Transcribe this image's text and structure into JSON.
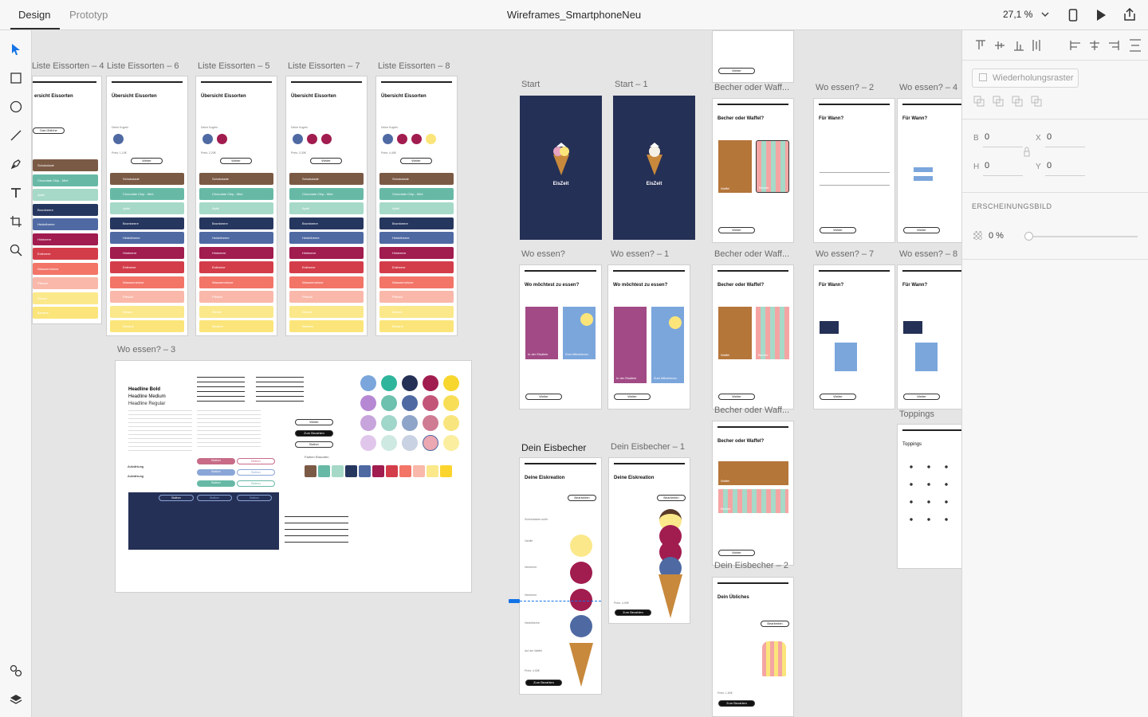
{
  "app": {
    "tabs": [
      "Design",
      "Prototyp"
    ],
    "document_title": "Wireframes_SmartphoneNeu",
    "zoom": "27,1 %"
  },
  "artboards": {
    "list_4": "Liste Eissorten – 4",
    "list_6": "Liste Eissorten – 6",
    "list_5": "Liste Eissorten – 5",
    "list_7": "Liste Eissorten – 7",
    "list_8": "Liste Eissorten – 8",
    "start": "Start",
    "start_1": "Start – 1",
    "wo_essen": "Wo essen?",
    "wo_essen_1": "Wo essen? – 1",
    "wo_essen_2": "Wo essen? – 2",
    "wo_essen_3": "Wo essen? – 3",
    "wo_essen_4": "Wo essen? – 4",
    "wo_essen_7": "Wo essen? – 7",
    "wo_essen_8": "Wo essen? – 8",
    "becher_1": "Becher oder Waff...",
    "becher_2": "Becher oder Waff...",
    "becher_3": "Becher oder Waff...",
    "dein_eisbecher": "Dein Eisbecher",
    "dein_eisbecher_1": "Dein Eisbecher – 1",
    "dein_eisbecher_2": "Dein Eisbecher – 2",
    "toppings": "Toppings"
  },
  "screens": {
    "uebersicht": "Übersicht Eissorten",
    "uebersicht_partial": "ersicht Eissorten",
    "deine_kugeln": "Deine Kugeln",
    "weiter": "Weiter",
    "preis_1": "Preis: 1,10€",
    "preis_2": "Preis: 2,20€",
    "preis_3": "Preis: 3,30€",
    "preis_4": "Preis: 4,40€",
    "das_uebliche": "Das Übliche",
    "flavors": [
      "Schokolade",
      "Chocolate Chip - Mint",
      "Apfel",
      "Brombeere",
      "Heidelbeere",
      "Himbeere",
      "Erdbeere",
      "Wassermelone",
      "Pfirsich",
      "Zitrone",
      "Banane"
    ],
    "app_name": "EisZeit",
    "wo_moechtest": "Wo möchtest zu essen?",
    "in_der_eisdiele": "In der Eisdiele",
    "zum_mitnehmen": "Zum Mitnehmen",
    "becher_oder_waffel": "Becher oder Waffel?",
    "waffel": "Waffel",
    "becher": "Becher",
    "fuer_wann": "Für Wann?",
    "dein_eiskreation": "Deine Eiskreation",
    "bearbeiten": "Bearbeiten",
    "zum_bezahlen": "Zum Bezahlen",
    "preis_490": "Preis: 4,90€",
    "dein_uebliches": "Dein Übliches",
    "preis_160": "Preis: 1,60€",
    "toppings_title": "Toppings",
    "scoop_labels": [
      "Schokoladen-soße",
      "Vanille",
      "Himbeere",
      "Himbeere",
      "Heidelbeere",
      "Auf der Waffel"
    ],
    "styleguide": {
      "headline_bold": "Headline Bold",
      "headline_medium": "Headline Medium",
      "headline_regular": "Headline Regular",
      "button": "Button",
      "weiter": "Weiter",
      "zum_bezahlen": "Zum Bezahlen",
      "farben_eissorten": "Farben Eissorten",
      "aufzaehlung": "Aufzählung"
    }
  },
  "right_panel": {
    "repeat_grid": "Wiederholungsraster",
    "b_label": "B",
    "b_value": "0",
    "x_label": "X",
    "x_value": "0",
    "h_label": "H",
    "h_value": "0",
    "y_label": "Y",
    "y_value": "0",
    "appearance": "ERSCHEINUNGSBILD",
    "opacity": "0 %"
  },
  "colors": {
    "navy": "#253056",
    "schoko": "#7b5a45",
    "mint": "#67b9a6",
    "apfel": "#a6d9c8",
    "brombeere": "#26375f",
    "heidelbeere": "#4f6aa3",
    "himbeere": "#a11c4f",
    "erdbeere": "#d33d4a",
    "wassermelone": "#f27568",
    "pfirsich": "#f9b8aa",
    "zitrone": "#fbe88a",
    "banane": "#fbe57a",
    "waffel": "#b5763a"
  }
}
